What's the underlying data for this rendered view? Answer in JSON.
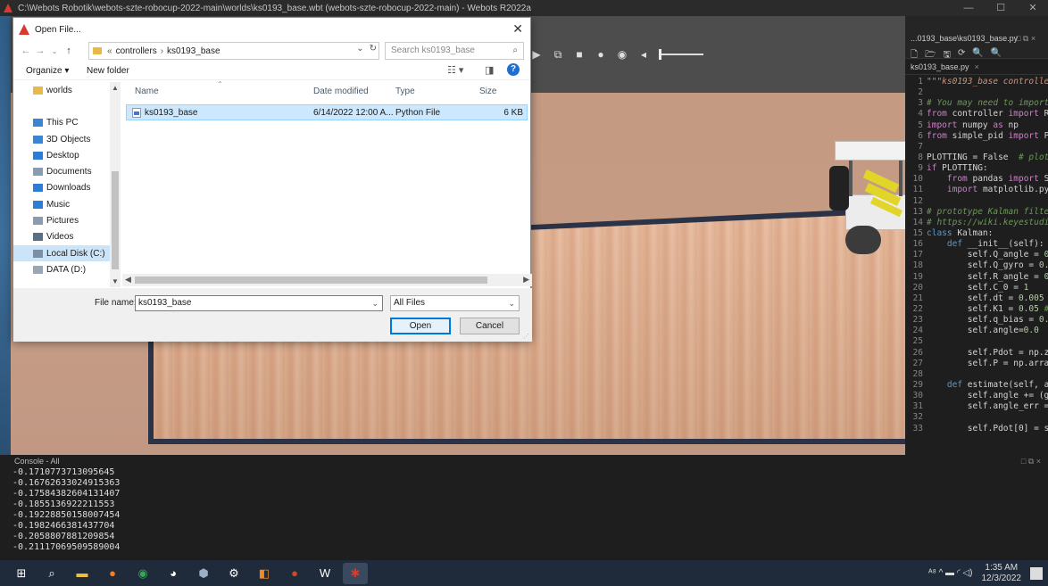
{
  "window": {
    "title": "C:\\Webots Robotik\\webots-szte-robocup-2022-main\\worlds\\ks0193_base.wbt (webots-szte-robocup-2022-main) - Webots R2022a",
    "minimize": "—",
    "maximize": "☐",
    "close": "✕"
  },
  "viewport_toolbar": [
    "▶",
    "⧉",
    "■",
    "●",
    "◉",
    "◂"
  ],
  "editor": {
    "title": "...0193_base\\ks0193_base.py",
    "tab": "ks0193_base.py",
    "tab_close": "×",
    "header_ctl": "□ ⧉ ×",
    "icons": [
      "🗋",
      "🗁",
      "🖫",
      "⟳",
      "🔍",
      "🔍"
    ],
    "lines": [
      {
        "n": "1",
        "parts": [
          [
            "str",
            "\"\"\"ks0193_base controller"
          ]
        ]
      },
      {
        "n": "2",
        "parts": [
          [
            "c",
            ""
          ]
        ]
      },
      {
        "n": "3",
        "parts": [
          [
            "cm",
            "# You may need to import"
          ]
        ]
      },
      {
        "n": "4",
        "parts": [
          [
            "kw",
            "from"
          ],
          [
            "c",
            " controller "
          ],
          [
            "kw",
            "import"
          ],
          [
            "c",
            " Ro"
          ]
        ]
      },
      {
        "n": "5",
        "parts": [
          [
            "kw",
            "import"
          ],
          [
            "c",
            " numpy "
          ],
          [
            "kw",
            "as"
          ],
          [
            "c",
            " np"
          ]
        ]
      },
      {
        "n": "6",
        "parts": [
          [
            "kw",
            "from"
          ],
          [
            "c",
            " simple_pid "
          ],
          [
            "kw",
            "import"
          ],
          [
            "c",
            " PI"
          ]
        ]
      },
      {
        "n": "7",
        "parts": [
          [
            "c",
            ""
          ]
        ]
      },
      {
        "n": "8",
        "parts": [
          [
            "c",
            "PLOTTING = False  "
          ],
          [
            "cm",
            "# plott"
          ]
        ]
      },
      {
        "n": "9",
        "parts": [
          [
            "kw",
            "if"
          ],
          [
            "c",
            " PLOTTING:"
          ]
        ]
      },
      {
        "n": "10",
        "parts": [
          [
            "c",
            "    "
          ],
          [
            "kw",
            "from"
          ],
          [
            "c",
            " pandas "
          ],
          [
            "kw",
            "import"
          ],
          [
            "c",
            " Se"
          ]
        ]
      },
      {
        "n": "11",
        "parts": [
          [
            "c",
            "    "
          ],
          [
            "kw",
            "import"
          ],
          [
            "c",
            " matplotlib.pyp"
          ]
        ]
      },
      {
        "n": "12",
        "parts": [
          [
            "c",
            ""
          ]
        ]
      },
      {
        "n": "13",
        "parts": [
          [
            "cm",
            "# prototype Kalman filter"
          ]
        ]
      },
      {
        "n": "14",
        "parts": [
          [
            "cm",
            "# https://wiki.keyestudio"
          ]
        ]
      },
      {
        "n": "15",
        "parts": [
          [
            "kw2",
            "class"
          ],
          [
            "c",
            " Kalman:"
          ]
        ]
      },
      {
        "n": "16",
        "parts": [
          [
            "c",
            "    "
          ],
          [
            "kw2",
            "def"
          ],
          [
            "c",
            " __init__(self):"
          ]
        ]
      },
      {
        "n": "17",
        "parts": [
          [
            "c",
            "        self.Q_angle = "
          ],
          [
            "num",
            "0."
          ]
        ]
      },
      {
        "n": "18",
        "parts": [
          [
            "c",
            "        self.Q_gyro = "
          ],
          [
            "num",
            "0.0"
          ]
        ]
      },
      {
        "n": "19",
        "parts": [
          [
            "c",
            "        self.R_angle = "
          ],
          [
            "num",
            "0."
          ]
        ]
      },
      {
        "n": "20",
        "parts": [
          [
            "c",
            "        self.C_0 = "
          ],
          [
            "num",
            "1"
          ]
        ]
      },
      {
        "n": "21",
        "parts": [
          [
            "c",
            "        self.dt = "
          ],
          [
            "num",
            "0.005"
          ],
          [
            "cm",
            " #"
          ]
        ]
      },
      {
        "n": "22",
        "parts": [
          [
            "c",
            "        self.K1 = "
          ],
          [
            "num",
            "0.05"
          ],
          [
            "cm",
            " #"
          ]
        ]
      },
      {
        "n": "23",
        "parts": [
          [
            "c",
            "        self.q_bias = "
          ],
          [
            "num",
            "0.0"
          ]
        ]
      },
      {
        "n": "24",
        "parts": [
          [
            "c",
            "        self.angle="
          ],
          [
            "num",
            "0.0"
          ]
        ]
      },
      {
        "n": "25",
        "parts": [
          [
            "c",
            ""
          ]
        ]
      },
      {
        "n": "26",
        "parts": [
          [
            "c",
            "        self.Pdot = np.ze"
          ]
        ]
      },
      {
        "n": "27",
        "parts": [
          [
            "c",
            "        self.P = np.array"
          ]
        ]
      },
      {
        "n": "28",
        "parts": [
          [
            "c",
            ""
          ]
        ]
      },
      {
        "n": "29",
        "parts": [
          [
            "c",
            "    "
          ],
          [
            "kw2",
            "def"
          ],
          [
            "c",
            " estimate(self, an"
          ]
        ]
      },
      {
        "n": "30",
        "parts": [
          [
            "c",
            "        self.angle += (gy"
          ]
        ]
      },
      {
        "n": "31",
        "parts": [
          [
            "c",
            "        self.angle_err = "
          ]
        ]
      },
      {
        "n": "32",
        "parts": [
          [
            "c",
            ""
          ]
        ]
      },
      {
        "n": "33",
        "parts": [
          [
            "c",
            "        self.Pdot[0] = se"
          ]
        ]
      }
    ]
  },
  "console": {
    "title": "Console - All",
    "ctl": "□ ⧉ ×",
    "lines": [
      "-0.1710773713095645",
      "-0.16762633024915363",
      "-0.17584382604131407",
      "-0.1855136922211553",
      "-0.19228850158007454",
      "-0.1982466381437704",
      "-0.2058807881209854",
      "-0.21117069509589004"
    ]
  },
  "dialog": {
    "title": "Open File...",
    "close": "✕",
    "breadcrumb": [
      "controllers",
      "ks0193_base"
    ],
    "breadcrumb_prefix": "«",
    "search_placeholder": "Search ks0193_base",
    "organize": "Organize ▾",
    "new_folder": "New folder",
    "nav_items": [
      {
        "label": "worlds",
        "icon": "folder",
        "color": "#e8b84a"
      },
      {
        "label": "",
        "icon": "",
        "color": ""
      },
      {
        "label": "This PC",
        "icon": "pc",
        "color": "#3a86d4"
      },
      {
        "label": "3D Objects",
        "icon": "cube",
        "color": "#3a86d4"
      },
      {
        "label": "Desktop",
        "icon": "desk",
        "color": "#2b7dd6"
      },
      {
        "label": "Documents",
        "icon": "doc",
        "color": "#8a9cb0"
      },
      {
        "label": "Downloads",
        "icon": "down",
        "color": "#2b7dd6"
      },
      {
        "label": "Music",
        "icon": "music",
        "color": "#2b7dd6"
      },
      {
        "label": "Pictures",
        "icon": "pic",
        "color": "#8a9cb0"
      },
      {
        "label": "Videos",
        "icon": "vid",
        "color": "#5a6f85"
      },
      {
        "label": "Local Disk (C:)",
        "icon": "disk",
        "color": "#7b8fa6"
      },
      {
        "label": "DATA (D:)",
        "icon": "disk",
        "color": "#9aa6b3"
      },
      {
        "label": "",
        "icon": "",
        "color": ""
      },
      {
        "label": "Network",
        "icon": "net",
        "color": "#2b7dd6"
      }
    ],
    "columns": {
      "name": "Name",
      "date": "Date modified",
      "type": "Type",
      "size": "Size"
    },
    "files": [
      {
        "name": "ks0193_base",
        "date": "6/14/2022 12:00 A...",
        "type": "Python File",
        "size": "6 KB"
      }
    ],
    "file_name_label": "File name:",
    "file_name_value": "ks0193_base",
    "file_type": "All Files",
    "open_label": "Open",
    "cancel_label": "Cancel"
  },
  "taskbar": {
    "apps": [
      {
        "name": "start-button",
        "glyph": "⊞",
        "color": "#ffffff"
      },
      {
        "name": "search-button",
        "glyph": "⌕",
        "color": "#ffffff"
      },
      {
        "name": "file-explorer",
        "glyph": "▬",
        "color": "#f0c040"
      },
      {
        "name": "firefox",
        "glyph": "●",
        "color": "#ff7a1a"
      },
      {
        "name": "chrome",
        "glyph": "◉",
        "color": "#34a853"
      },
      {
        "name": "discord",
        "glyph": "◕",
        "color": "#ffffff"
      },
      {
        "name": "app-6",
        "glyph": "⬢",
        "color": "#9ab0c8"
      },
      {
        "name": "app-7",
        "glyph": "⚙",
        "color": "#ffffff"
      },
      {
        "name": "app-8",
        "glyph": "◧",
        "color": "#f08a24"
      },
      {
        "name": "powerpoint",
        "glyph": "●",
        "color": "#d24726"
      },
      {
        "name": "word",
        "glyph": "W",
        "color": "#ffffff"
      },
      {
        "name": "webots",
        "glyph": "✱",
        "color": "#d83a2e"
      }
    ],
    "tray": "ᴬ⁸   ^  ▬  ◜  ◁)",
    "time": "1:35 AM",
    "date": "12/3/2022"
  }
}
